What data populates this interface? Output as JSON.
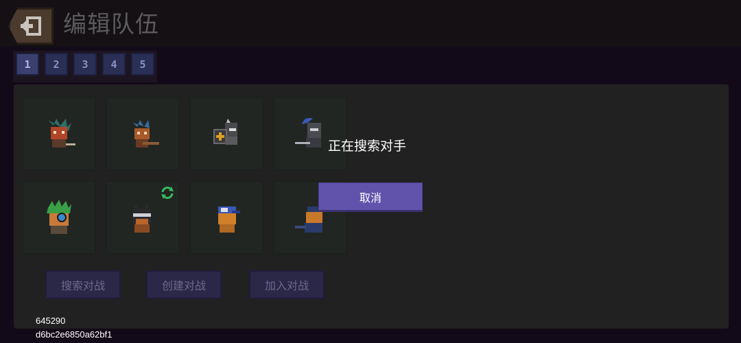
{
  "header": {
    "title": "编辑队伍",
    "back_icon": "exit-door-icon"
  },
  "tabs": [
    {
      "label": "1",
      "active": true
    },
    {
      "label": "2",
      "active": false
    },
    {
      "label": "3",
      "active": false
    },
    {
      "label": "4",
      "active": false
    },
    {
      "label": "5",
      "active": false
    }
  ],
  "slots": [
    {
      "character": "feathered-rogue-character"
    },
    {
      "character": "crossbow-hunter-character"
    },
    {
      "character": "armored-knight-with-shield-character"
    },
    {
      "character": "plumed-knight-character"
    },
    {
      "character": "green-haired-engineer-character"
    },
    {
      "character": "ninja-character",
      "badge_icon": "refresh-icon"
    },
    {
      "character": "cap-wearing-kid-character"
    },
    {
      "character": "police-officer-character"
    }
  ],
  "actions": {
    "search_battle": "搜索对战",
    "create_battle": "创建对战",
    "join_battle": "加入对战"
  },
  "dialog": {
    "message": "正在搜索对手",
    "cancel": "取消"
  },
  "debug": {
    "line1": "645290",
    "line2": "d6bc2e6850a62bf1"
  },
  "colors": {
    "accent": "#6153ac",
    "tab": "#2a2f55"
  }
}
